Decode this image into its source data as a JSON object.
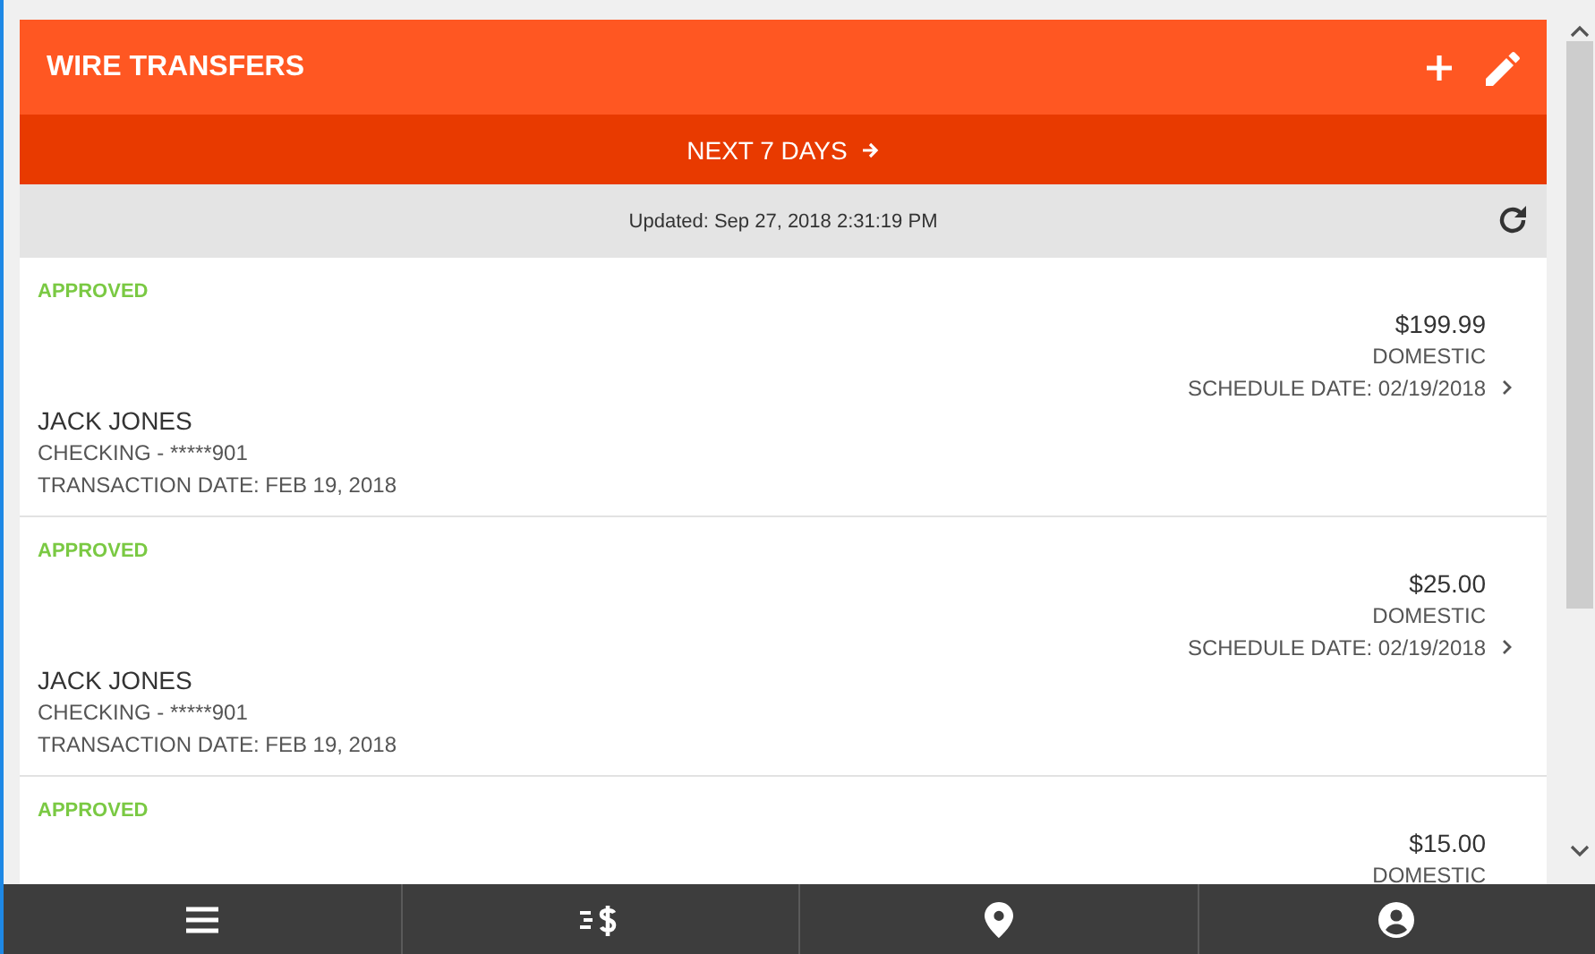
{
  "header": {
    "title": "WIRE TRANSFERS"
  },
  "period_button": {
    "label": "NEXT 7 DAYS"
  },
  "updated": {
    "text": "Updated: Sep 27, 2018 2:31:19 PM"
  },
  "transfers": [
    {
      "status": "APPROVED",
      "amount": "$199.99",
      "type": "DOMESTIC",
      "schedule_date": "SCHEDULE DATE: 02/19/2018",
      "name": "JACK JONES",
      "account": "CHECKING - *****901",
      "transaction_date": "TRANSACTION DATE: FEB 19, 2018"
    },
    {
      "status": "APPROVED",
      "amount": "$25.00",
      "type": "DOMESTIC",
      "schedule_date": "SCHEDULE DATE: 02/19/2018",
      "name": "JACK JONES",
      "account": "CHECKING - *****901",
      "transaction_date": "TRANSACTION DATE: FEB 19, 2018"
    },
    {
      "status": "APPROVED",
      "amount": "$15.00",
      "type": "DOMESTIC"
    }
  ],
  "bottom_nav": [
    {
      "kind": "menu"
    },
    {
      "kind": "transfer"
    },
    {
      "kind": "location"
    },
    {
      "kind": "account"
    }
  ]
}
